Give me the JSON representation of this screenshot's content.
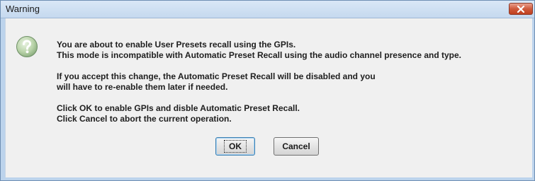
{
  "window": {
    "title": "Warning",
    "close_icon": "close-icon"
  },
  "icon": "question-icon",
  "message": {
    "line1": "You are about to enable User Presets recall using the GPIs.",
    "line2": "This mode is incompatible with Automatic Preset Recall using the audio channel presence and type.",
    "line3": "If you accept this change, the Automatic Preset Recall will be disabled and you",
    "line4": "will have to re-enable them later if needed.",
    "line5": "Click OK to enable GPIs and disble Automatic Preset Recall.",
    "line6": "Click Cancel to abort the current operation."
  },
  "buttons": {
    "ok_label": "OK",
    "cancel_label": "Cancel"
  },
  "colors": {
    "frame": "#bcd3ec",
    "close_button": "#c7442a",
    "dialog_body": "#f0f0f0"
  }
}
